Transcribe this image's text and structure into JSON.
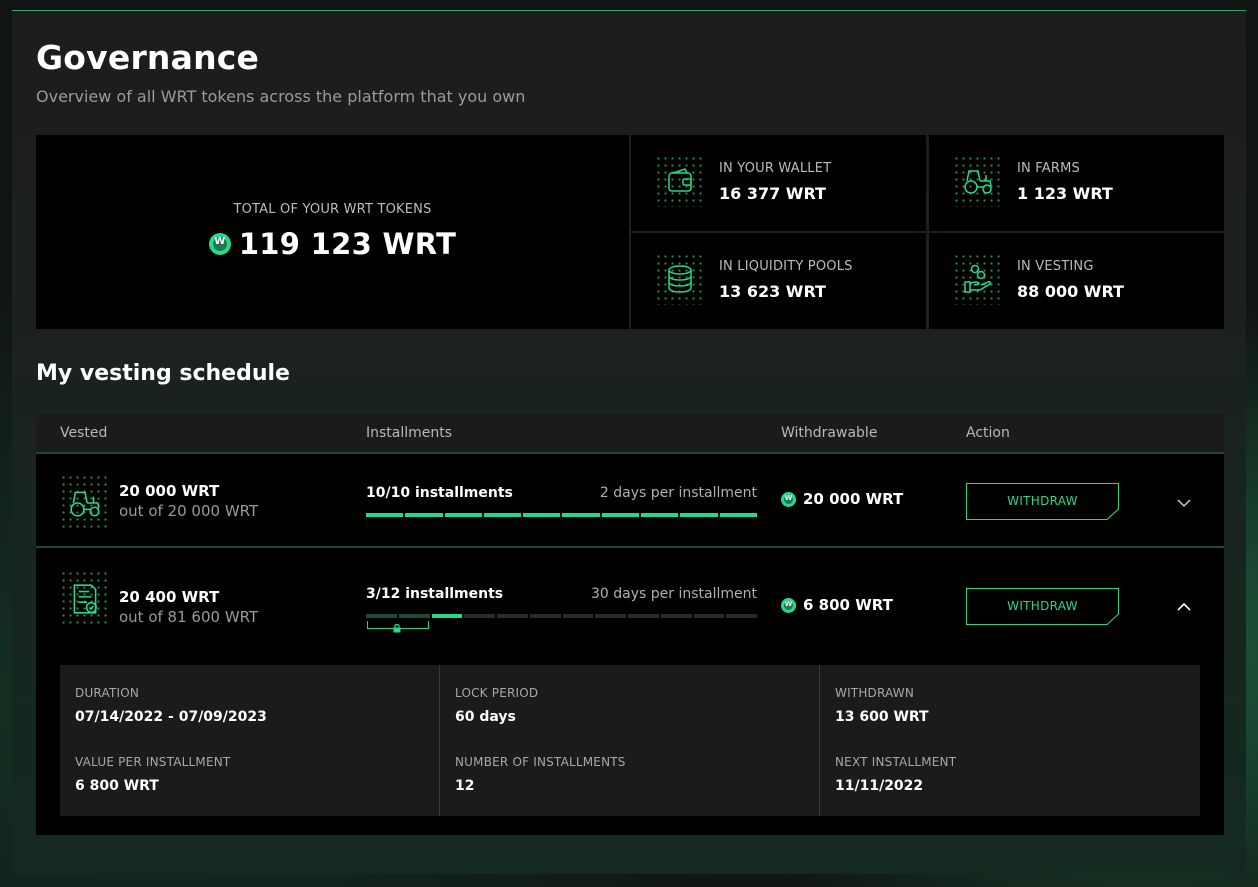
{
  "header": {
    "title": "Governance",
    "subtitle": "Overview of all WRT tokens across the platform that you own"
  },
  "summary": {
    "total_label": "TOTAL OF YOUR WRT TOKENS",
    "total_value": "119 123 WRT",
    "coin_glyph": "W",
    "stats": [
      {
        "label": "IN YOUR WALLET",
        "value": "16 377 WRT",
        "icon": "wallet-icon"
      },
      {
        "label": "IN FARMS",
        "value": "1 123 WRT",
        "icon": "tractor-icon"
      },
      {
        "label": "IN LIQUIDITY POOLS",
        "value": "13 623 WRT",
        "icon": "coin-stack-icon"
      },
      {
        "label": "IN VESTING",
        "value": "88 000 WRT",
        "icon": "hand-coins-icon"
      }
    ]
  },
  "vesting": {
    "title": "My vesting schedule",
    "columns": [
      "Vested",
      "Installments",
      "Withdrawable",
      "Action"
    ],
    "rows": [
      {
        "icon": "tractor-icon",
        "vested": "20 000 WRT",
        "vested_of": "out of 20 000 WRT",
        "installments": "10/10 installments",
        "rate": "2 days per installment",
        "total_installments": 10,
        "done_installments": 10,
        "withdrawable": "20 000 WRT",
        "action": "WITHDRAW",
        "expanded": false
      },
      {
        "icon": "document-check-icon",
        "vested": "20 400 WRT",
        "vested_of": "out of 81 600 WRT",
        "installments": "3/12 installments",
        "rate": "30 days per installment",
        "total_installments": 12,
        "done_installments": 3,
        "locked_installments": 2,
        "withdrawable": "6 800 WRT",
        "action": "WITHDRAW",
        "expanded": true,
        "details": {
          "duration_label": "DURATION",
          "duration": "07/14/2022 - 07/09/2023",
          "value_label": "VALUE PER INSTALLMENT",
          "value": "6 800 WRT",
          "lock_label": "LOCK PERIOD",
          "lock": "60 days",
          "count_label": "NUMBER OF INSTALLMENTS",
          "count": "12",
          "withdrawn_label": "WITHDRAWN",
          "withdrawn": "13 600 WRT",
          "next_label": "NEXT INSTALLMENT",
          "next": "11/11/2022"
        }
      }
    ]
  },
  "colors": {
    "accent": "#25d98b",
    "accent_dim": "#1d4a36",
    "panel": "#1b1d1c",
    "cell": "#000000"
  }
}
